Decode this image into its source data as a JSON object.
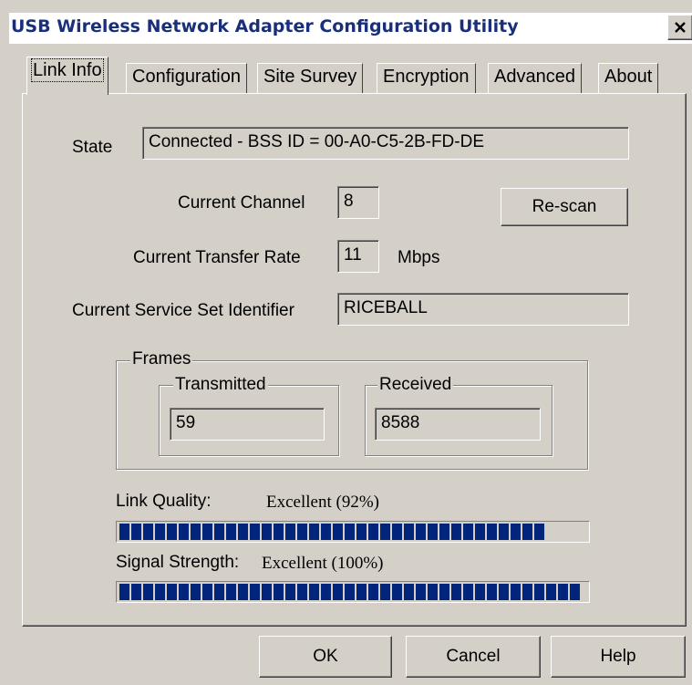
{
  "window": {
    "title": "USB Wireless Network Adapter Configuration Utility",
    "close_glyph": "✕"
  },
  "tabs": [
    {
      "label": "Link Info",
      "active": true
    },
    {
      "label": "Configuration",
      "active": false
    },
    {
      "label": "Site Survey",
      "active": false
    },
    {
      "label": "Encryption",
      "active": false
    },
    {
      "label": "Advanced",
      "active": false
    },
    {
      "label": "About",
      "active": false
    }
  ],
  "link_info": {
    "state_label": "State",
    "state_value": "Connected - BSS ID = 00-A0-C5-2B-FD-DE",
    "channel_label": "Current Channel",
    "channel_value": "8",
    "rescan_label": "Re-scan",
    "rate_label": "Current Transfer Rate",
    "rate_value": "11",
    "rate_unit": "Mbps",
    "ssid_label": "Current Service Set Identifier",
    "ssid_value": "RICEBALL"
  },
  "frames": {
    "title": "Frames",
    "transmitted_label": "Transmitted",
    "transmitted_value": "59",
    "received_label": "Received",
    "received_value": "8588"
  },
  "link_quality": {
    "label": "Link Quality:",
    "value_text": "Excellent (92%)",
    "percent": 92
  },
  "signal_strength": {
    "label": "Signal Strength:",
    "value_text": "Excellent (100%)",
    "percent": 100
  },
  "buttons": {
    "ok": "OK",
    "cancel": "Cancel",
    "help": "Help"
  },
  "colors": {
    "title_text": "#1a2f7a",
    "bar_fill": "#00257a",
    "window_bg": "#d4d0c8"
  }
}
